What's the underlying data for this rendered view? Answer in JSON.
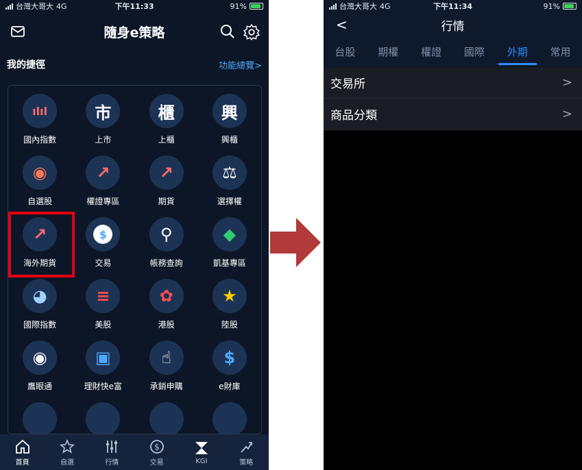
{
  "left": {
    "status": {
      "carrier": "台灣大哥大",
      "network": "4G",
      "time": "下午11:33",
      "battery": "91%"
    },
    "header": {
      "title": "隨身e策略"
    },
    "section": {
      "title": "我的捷徑",
      "link": "功能總覽>"
    },
    "shortcuts": [
      {
        "label": "國內指數",
        "glyph": "ılıl"
      },
      {
        "label": "上市",
        "glyph": "市"
      },
      {
        "label": "上櫃",
        "glyph": "櫃"
      },
      {
        "label": "興櫃",
        "glyph": "興"
      },
      {
        "label": "自選股",
        "glyph": "◉"
      },
      {
        "label": "權證專區",
        "glyph": "↗"
      },
      {
        "label": "期貨",
        "glyph": "↗"
      },
      {
        "label": "選擇權",
        "glyph": "⚖"
      },
      {
        "label": "海外期貨",
        "glyph": "↗"
      },
      {
        "label": "交易",
        "glyph": "$"
      },
      {
        "label": "帳務查詢",
        "glyph": "⚲"
      },
      {
        "label": "凱基專區",
        "glyph": "◆"
      },
      {
        "label": "國際指數",
        "glyph": "◕"
      },
      {
        "label": "美股",
        "glyph": "≡"
      },
      {
        "label": "港股",
        "glyph": "✿"
      },
      {
        "label": "陸股",
        "glyph": "★"
      },
      {
        "label": "鷹眼通",
        "glyph": "◉"
      },
      {
        "label": "理財快e富",
        "glyph": "▣"
      },
      {
        "label": "承銷申購",
        "glyph": "☝"
      },
      {
        "label": "e財庫",
        "glyph": "$"
      }
    ],
    "tabbar": [
      {
        "label": "首頁"
      },
      {
        "label": "自選"
      },
      {
        "label": "行情"
      },
      {
        "label": "交易"
      },
      {
        "label": "KGI"
      },
      {
        "label": "策略"
      }
    ]
  },
  "right": {
    "status": {
      "carrier": "台灣大哥大",
      "network": "4G",
      "time": "下午11:34",
      "battery": "91%"
    },
    "header": {
      "title": "行情",
      "back": "<"
    },
    "tabs": [
      "台股",
      "期權",
      "權證",
      "國際",
      "外期",
      "常用"
    ],
    "active_tab": "外期",
    "list": [
      {
        "label": "交易所",
        "chevron": ">"
      },
      {
        "label": "商品分類",
        "chevron": ">"
      }
    ]
  },
  "colors": {
    "accent": "#2d8cff",
    "highlight": "#e60012",
    "arrow": "#b23a3a",
    "bg_dark": "#0c1626"
  }
}
